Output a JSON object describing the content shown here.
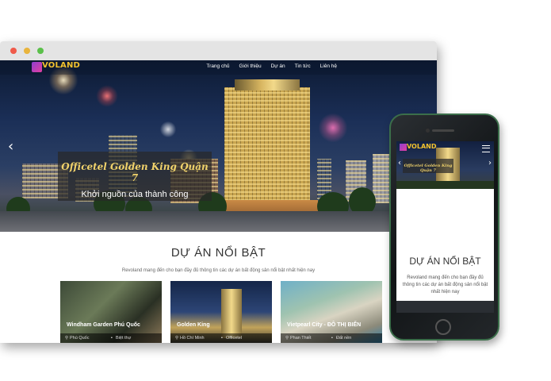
{
  "nav": {
    "logo": "VOLAND",
    "items": [
      "Trang chủ",
      "Giới thiệu",
      "Dự án",
      "Tin tức",
      "Liên hệ"
    ]
  },
  "hero": {
    "title": "Officetel Golden King Quận 7",
    "subtitle": "Khởi nguồn của thành công",
    "prev_arrow": "‹",
    "next_arrow": "›"
  },
  "section": {
    "title": "DỰ ÁN NỔI BẬT",
    "description": "Revoland mang đến cho bạn đầy đủ thông tin các dự án bất động sản nổi bật nhất hiện nay"
  },
  "cards": [
    {
      "title": "Windham Garden Phú Quốc",
      "location": "Phú Quốc",
      "type": "Biệt thự"
    },
    {
      "title": "Golden King",
      "location": "Hồ Chí Minh",
      "type": "Officetel"
    },
    {
      "title": "Vietpearl City - ĐÔ THỊ BIỂN",
      "location": "Phan Thiết",
      "type": "Đất nền"
    }
  ],
  "mobile": {
    "logo": "VOLAND",
    "hero_title": "Officetel Golden King Quận 7",
    "section_title": "DỰ ÁN NỔI BẬT",
    "description": "Revoland mang đến cho bạn đầy đủ thông tin các dự án bất động sản nổi bật nhất hiện nay"
  },
  "colors": {
    "accent_gold": "#f1d36b",
    "logo_yellow": "#f3c22e",
    "logo_purple": "#8e3fd0",
    "dot_red": "#f05a4a",
    "dot_yellow": "#e9b43c",
    "dot_green": "#5bc04a"
  },
  "icons": [
    "location-icon",
    "category-icon",
    "hamburger-menu-icon",
    "chevron-left-icon",
    "chevron-right-icon"
  ]
}
